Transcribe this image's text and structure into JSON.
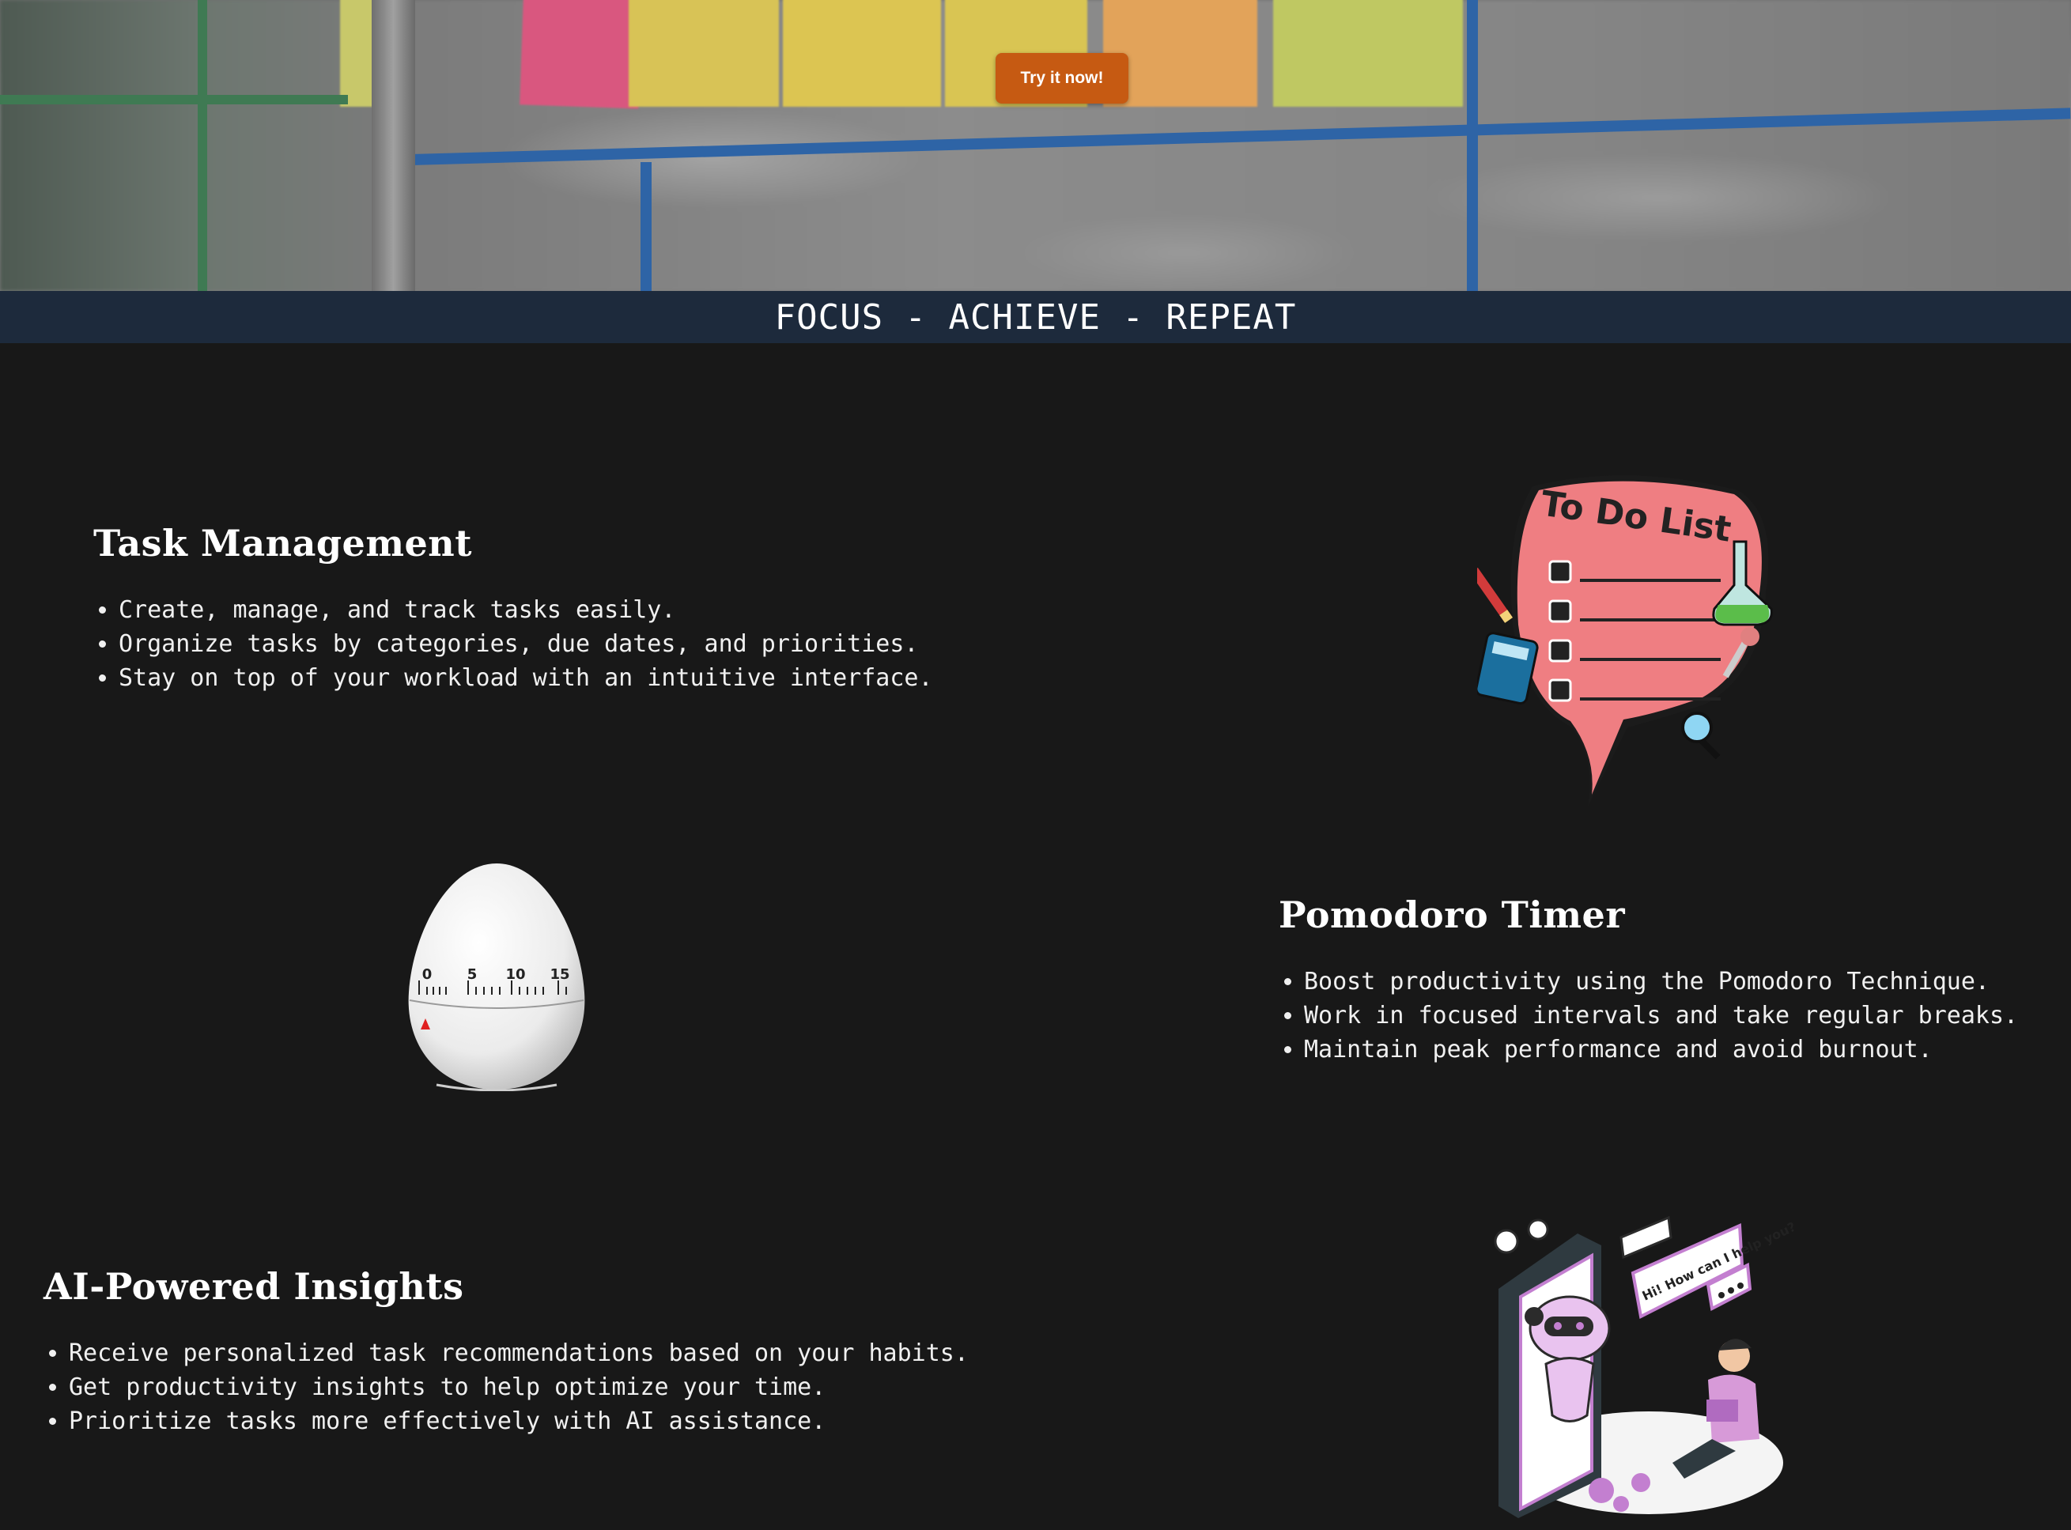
{
  "hero": {
    "cta_label": "Try it now!",
    "accent_color": "#c65a12"
  },
  "banner": {
    "tagline": "FOCUS - ACHIEVE - REPEAT"
  },
  "features": [
    {
      "title": "Task Management",
      "points": [
        "Create, manage, and track tasks easily.",
        "Organize tasks by categories, due dates, and priorities.",
        "Stay on top of your workload with an intuitive interface."
      ],
      "image_text": "To Do List",
      "image_icon": "to-do-list-illustration"
    },
    {
      "title": "Pomodoro Timer",
      "points": [
        "Boost productivity using the Pomodoro Technique.",
        "Work in focused intervals and take regular breaks.",
        "Maintain peak performance and avoid burnout."
      ],
      "image_icon": "egg-timer-image",
      "dial_labels": [
        "0",
        "5",
        "10",
        "15"
      ]
    },
    {
      "title": "AI-Powered Insights",
      "points": [
        "Receive personalized task recommendations based on your habits.",
        "Get productivity insights to help optimize your time.",
        "Prioritize tasks more effectively with AI assistance."
      ],
      "image_icon": "ai-assistant-illustration",
      "bubble_text": "Hi! How can I help you?"
    }
  ]
}
